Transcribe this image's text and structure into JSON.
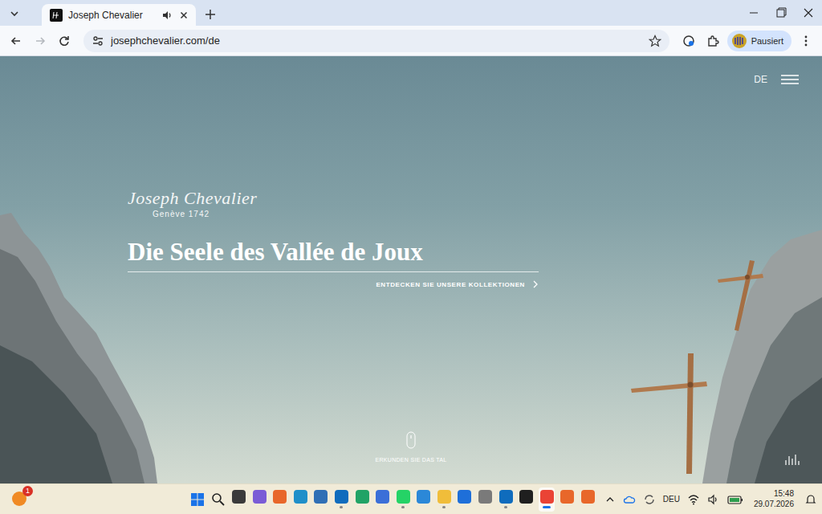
{
  "tab": {
    "title": "Joseph Chevalier",
    "selected": true,
    "audio": true
  },
  "nav": {
    "back_enabled": true,
    "forward_enabled": false
  },
  "address": {
    "url": "josephchevalier.com/de",
    "bookmarked": false
  },
  "profile": {
    "label": "Pausiert"
  },
  "site": {
    "language": "DE",
    "logo": "Joseph Chevalier",
    "logo_sub": "Genève 1742",
    "headline": "Die Seele des Vallée de Joux",
    "cta": "ENTDECKEN SIE UNSERE KOLLEKTIONEN",
    "scroll_hint": "ERKUNDEN SIE DAS TAL"
  },
  "taskbar": {
    "badge": "1",
    "apps": [
      {
        "color": "#3a3a3a",
        "running": false,
        "selected": false
      },
      {
        "color": "#7a5cd6",
        "running": false,
        "selected": false
      },
      {
        "color": "#e8672a",
        "running": false,
        "selected": false
      },
      {
        "color": "#1f8fc9",
        "running": false,
        "selected": false
      },
      {
        "color": "#2f6fb5",
        "running": false,
        "selected": false
      },
      {
        "color": "#0f6cbd",
        "running": true,
        "selected": false
      },
      {
        "color": "#21a366",
        "running": false,
        "selected": false
      },
      {
        "color": "#3b6fd8",
        "running": false,
        "selected": false
      },
      {
        "color": "#25d366",
        "running": true,
        "selected": false
      },
      {
        "color": "#2b88d8",
        "running": false,
        "selected": false
      },
      {
        "color": "#f0bd3a",
        "running": true,
        "selected": false
      },
      {
        "color": "#1e6fd9",
        "running": false,
        "selected": false
      },
      {
        "color": "#7a7a7a",
        "running": false,
        "selected": false
      },
      {
        "color": "#0f6cbd",
        "running": true,
        "selected": false
      },
      {
        "color": "#1f1f1f",
        "running": false,
        "selected": false
      },
      {
        "color": "#ea4335",
        "running": true,
        "selected": true
      },
      {
        "color": "#e8672a",
        "running": false,
        "selected": false
      },
      {
        "color": "#e8672a",
        "running": false,
        "selected": false
      }
    ],
    "language": "DEU",
    "time": "15:48",
    "date": "29.07.2026"
  }
}
